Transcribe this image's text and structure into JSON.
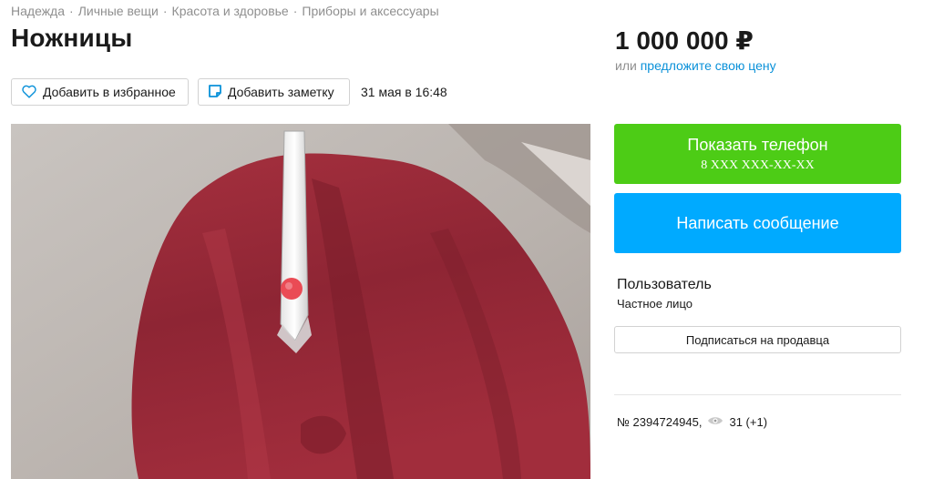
{
  "breadcrumbs": [
    "Надежда",
    "Личные вещи",
    "Красота и здоровье",
    "Приборы и аксессуары"
  ],
  "breadcrumb_separator": "·",
  "title": "Ножницы",
  "price": "1 000 000 ₽",
  "offer": {
    "prefix": "или",
    "link": "предложите свою цену"
  },
  "actions": {
    "favorite_label": "Добавить в избранное",
    "note_label": "Добавить заметку",
    "date": "31 мая в 16:48"
  },
  "contact": {
    "show_phone_label": "Показать телефон",
    "phone_masked": "8 XXX XXX-XX-XX",
    "message_label": "Написать сообщение"
  },
  "seller": {
    "name": "Пользователь",
    "type": "Частное лицо",
    "subscribe_label": "Подписаться на продавца"
  },
  "listing": {
    "id": "№ 2394724945,",
    "views": "31 (+1)"
  },
  "icons": {
    "favorite": "heart-icon",
    "note": "note-icon",
    "views": "eye-icon"
  },
  "colors": {
    "accent_link": "#0a91d9",
    "phone_button": "#4dcc16",
    "message_button": "#00aaff"
  }
}
